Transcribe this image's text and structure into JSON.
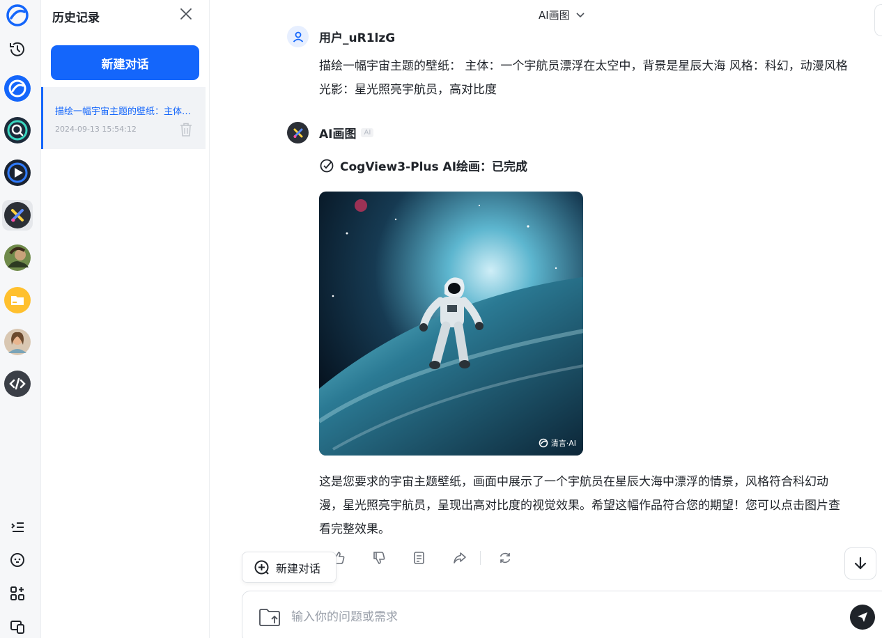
{
  "history": {
    "title": "历史记录",
    "new_chat_label": "新建对话",
    "items": [
      {
        "title": "描绘一幅宇宙主题的壁纸：主体：一个宇航员漂浮在太空中",
        "date": "2024-09-13 15:54:12"
      }
    ]
  },
  "topbar": {
    "title": "AI画图"
  },
  "conversation": {
    "user": {
      "name": "用户_uR1lzG",
      "message": "描绘一幅宇宙主题的壁纸： 主体：一个宇航员漂浮在太空中，背景是星辰大海 风格：科幻，动漫风格 光影：星光照亮宇航员，高对比度"
    },
    "bot": {
      "name": "AI画图",
      "badge": "AI",
      "status": "CogView3-Plus AI绘画：已完成",
      "watermark": "清言·AI",
      "reply": "这是您要求的宇宙主题壁纸，画面中展示了一个宇航员在星辰大海中漂浮的情景，风格符合科幻动漫，星光照亮宇航员，呈现出高对比度的视觉效果。希望这幅作品符合您的期望！您可以点击图片查看完整效果。"
    }
  },
  "floating": {
    "new_chat_label": "新建对话"
  },
  "input": {
    "placeholder": "输入你的问题或需求",
    "value": ""
  },
  "colors": {
    "accent": "#1466fb",
    "text": "#1f2329",
    "muted": "#a3a8b2"
  }
}
